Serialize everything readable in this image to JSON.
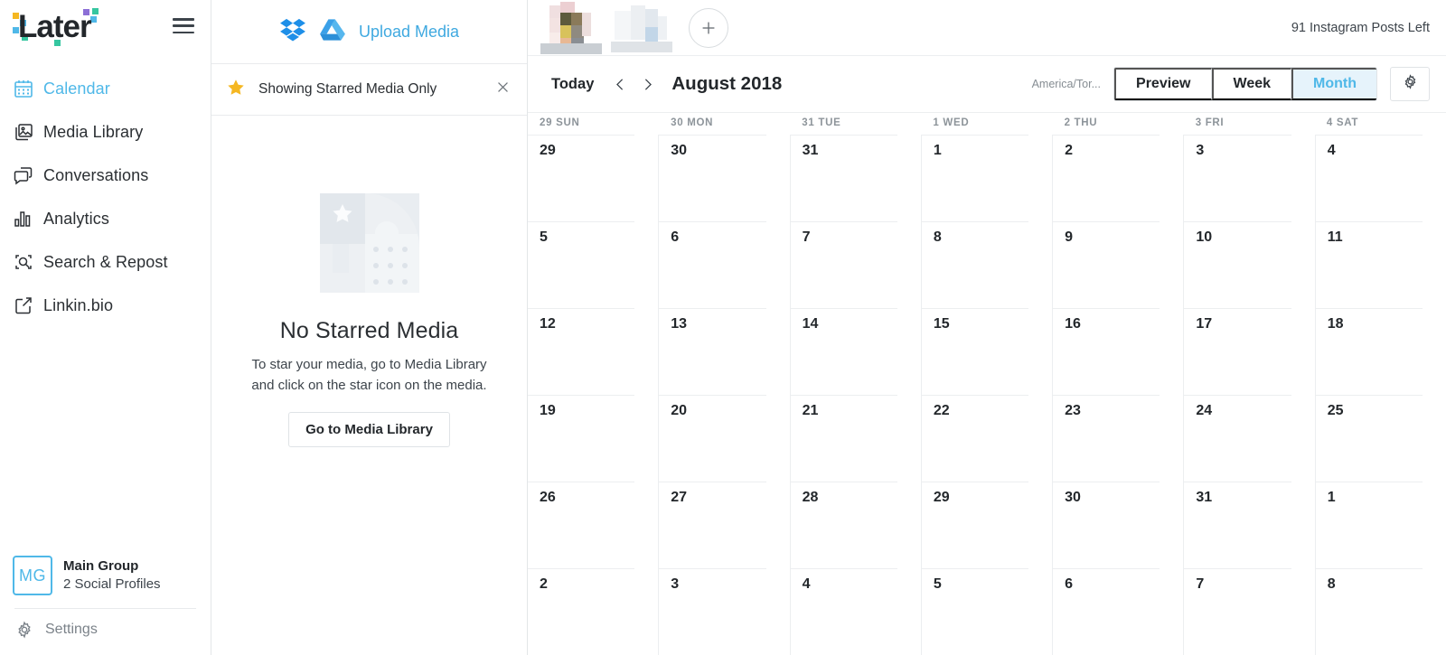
{
  "brand": {
    "name": "Later",
    "accent": "#4FB8E8",
    "link": "#3FA9E0",
    "star": "#F5B722"
  },
  "sidebar": {
    "menu_icon": "hamburger-icon",
    "items": [
      {
        "label": "Calendar",
        "icon": "calendar-icon",
        "active": true
      },
      {
        "label": "Media Library",
        "icon": "image-icon",
        "active": false
      },
      {
        "label": "Conversations",
        "icon": "chat-icon",
        "active": false
      },
      {
        "label": "Analytics",
        "icon": "bar-chart-icon",
        "active": false
      },
      {
        "label": "Search & Repost",
        "icon": "search-repost-icon",
        "active": false
      },
      {
        "label": "Linkin.bio",
        "icon": "link-icon",
        "active": false
      }
    ],
    "group": {
      "initials": "MG",
      "name": "Main Group",
      "subtitle": "2 Social Profiles"
    },
    "settings_label": "Settings"
  },
  "media_panel": {
    "dropbox_icon": "dropbox-icon",
    "gdrive_icon": "google-drive-icon",
    "upload_label": "Upload Media",
    "filter": {
      "label": "Showing Starred Media Only",
      "star_icon": "star-icon",
      "close_icon": "close-icon"
    },
    "empty": {
      "title": "No Starred Media",
      "line1": "To star your media, go to Media Library",
      "line2": "and click on the star icon on the media.",
      "button_label": "Go to Media Library"
    }
  },
  "topbar": {
    "add_icon": "plus-icon",
    "posts_left": "91 Instagram Posts Left",
    "profiles": [
      {
        "name": "profile-thumbnail-1"
      },
      {
        "name": "profile-thumbnail-2"
      }
    ]
  },
  "calendar": {
    "today_label": "Today",
    "prev_icon": "chevron-left-icon",
    "next_icon": "chevron-right-icon",
    "title": "August 2018",
    "timezone": "America/Tor...",
    "views": [
      {
        "label": "Preview",
        "active": false
      },
      {
        "label": "Week",
        "active": false
      },
      {
        "label": "Month",
        "active": true
      }
    ],
    "settings_icon": "gear-icon",
    "day_headers": [
      "29 SUN",
      "30 MON",
      "31 TUE",
      "1 WED",
      "2 THU",
      "3 FRI",
      "4 SAT"
    ],
    "weeks": [
      [
        "29",
        "30",
        "31",
        "1",
        "2",
        "3",
        "4"
      ],
      [
        "5",
        "6",
        "7",
        "8",
        "9",
        "10",
        "11"
      ],
      [
        "12",
        "13",
        "14",
        "15",
        "16",
        "17",
        "18"
      ],
      [
        "19",
        "20",
        "21",
        "22",
        "23",
        "24",
        "25"
      ],
      [
        "26",
        "27",
        "28",
        "29",
        "30",
        "31",
        "1"
      ],
      [
        "2",
        "3",
        "4",
        "5",
        "6",
        "7",
        "8"
      ]
    ]
  }
}
